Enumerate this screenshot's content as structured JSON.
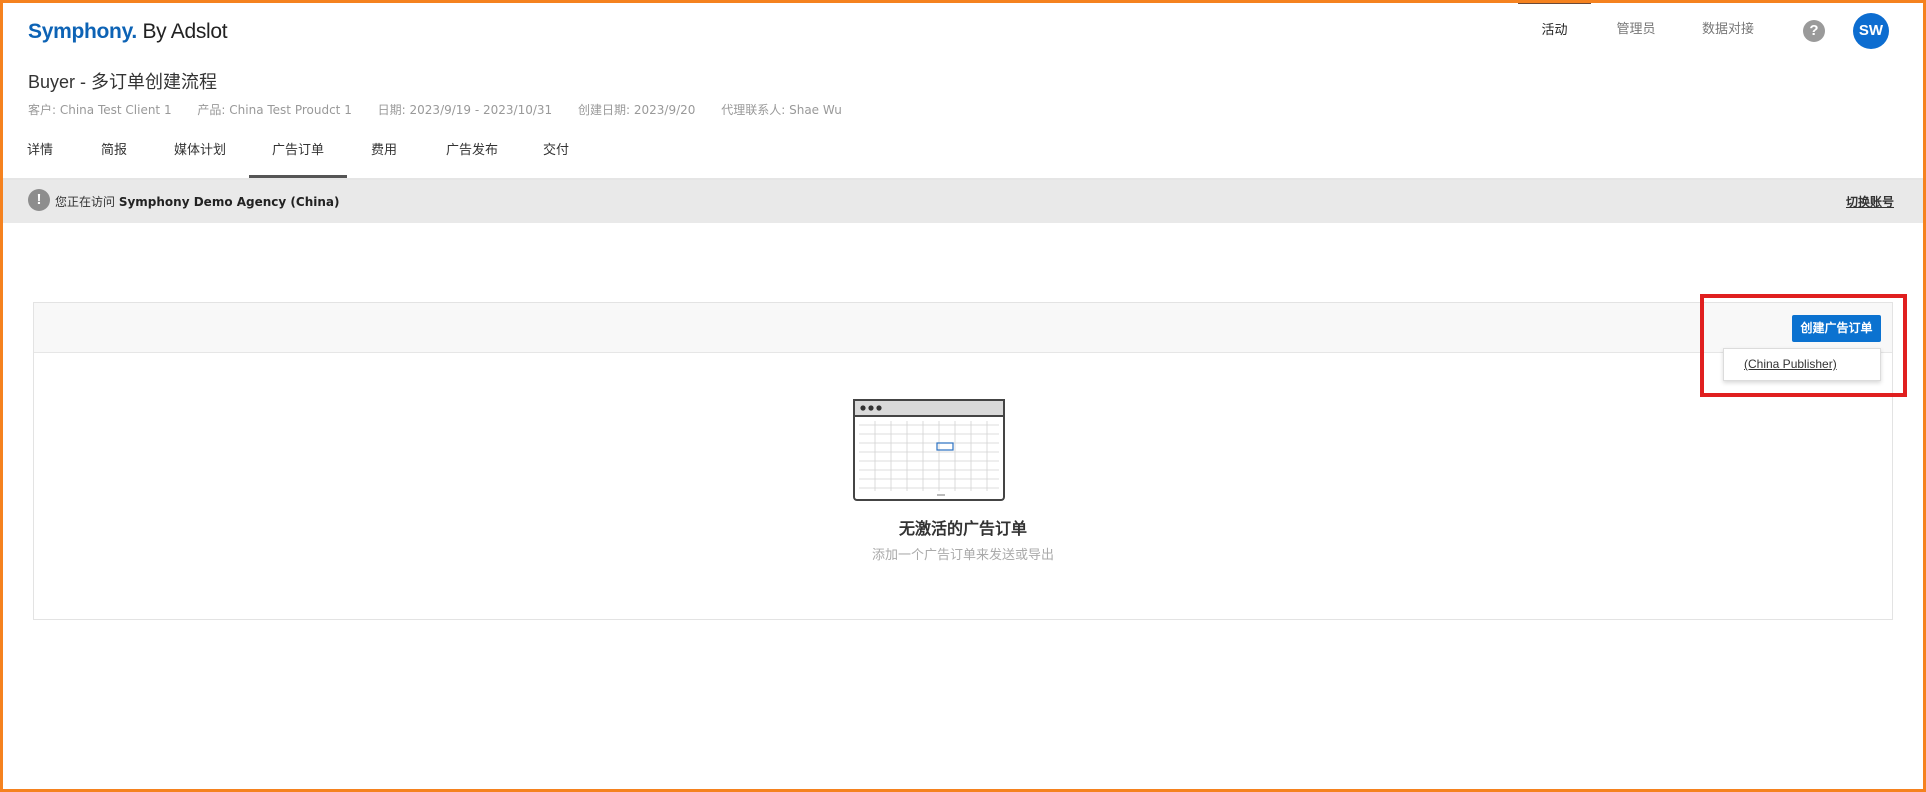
{
  "app": {
    "logo_brand": "Symphony.",
    "logo_suffix": " By Adslot"
  },
  "topnav": {
    "items": [
      {
        "label": "活动",
        "active": true
      },
      {
        "label": "管理员",
        "active": false
      },
      {
        "label": "数据对接",
        "active": false
      }
    ],
    "help_label": "?",
    "avatar_initials": "SW"
  },
  "campaign": {
    "title": "Buyer - 多订单创建流程",
    "meta": [
      "客户: China Test Client 1",
      "产品: China Test Proudct 1",
      "日期: 2023/9/19 - 2023/10/31",
      "创建日期: 2023/9/20",
      "代理联系人: Shae Wu"
    ]
  },
  "tabs": [
    {
      "label": "详情",
      "active": false
    },
    {
      "label": "简报",
      "active": false
    },
    {
      "label": "媒体计划",
      "active": false
    },
    {
      "label": "广告订单",
      "active": true
    },
    {
      "label": "费用",
      "active": false
    },
    {
      "label": "广告发布",
      "active": false
    },
    {
      "label": "交付",
      "active": false
    }
  ],
  "banner": {
    "icon": "!",
    "prefix": "您正在访问 ",
    "agency": "Symphony Demo Agency (China)",
    "switch_label": "切换账号"
  },
  "orders": {
    "create_label": "创建广告订单",
    "dropdown_items": [
      "(China Publisher)"
    ],
    "empty_title": "无激活的广告订单",
    "empty_subtitle": "添加一个广告订单来发送或导出"
  },
  "colors": {
    "brand": "#0d63b5",
    "primary_button": "#0b72d0",
    "avatar": "#0d6dd0",
    "highlight": "#e01f1f",
    "frame": "#f5821f"
  }
}
